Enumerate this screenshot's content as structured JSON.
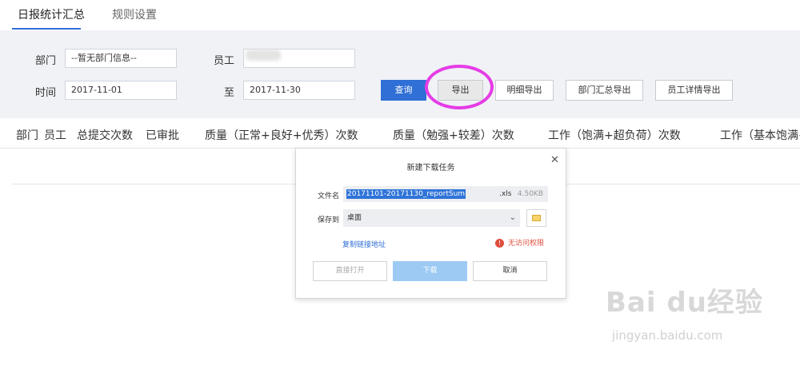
{
  "tabs": {
    "active": "日报统计汇总",
    "other": "规则设置"
  },
  "filters": {
    "dept_label": "部门",
    "dept_value": "--暂无部门信息--",
    "staff_label": "员工",
    "time_label": "时间",
    "start_date": "2017-11-01",
    "to_label": "至",
    "end_date": "2017-11-30"
  },
  "buttons": {
    "query": "查询",
    "export": "导出",
    "detail_export": "明细导出",
    "dept_summary_export": "部门汇总导出",
    "staff_detail_export": "员工详情导出"
  },
  "table": {
    "headers": [
      "部门",
      "员工",
      "总提交次数",
      "已审批",
      "质量（正常+良好+优秀）次数",
      "质量（勉强+较差）次数",
      "工作（饱满+超负荷）次数",
      "工作（基本饱满+"
    ]
  },
  "dialog": {
    "title": "新建下载任务",
    "close": "✕",
    "filename_label": "文件名",
    "filename_selected": "20171101-20171130_reportSum",
    "filename_ext": ".xls",
    "filesize": "4.50KB",
    "saveto_label": "保存到",
    "saveto_value": "桌面",
    "copy_link": "复制链接地址",
    "warning_icon": "!",
    "warning": "无访问权限",
    "open_direct": "直接打开",
    "download": "下载",
    "cancel": "取消"
  },
  "watermark": {
    "text": "Bai du经验",
    "url": "jingyan.baidu.com"
  },
  "colors": {
    "primary": "#2f6fd6",
    "highlight_circle": "#e53ce6",
    "warning": "#e04f3d"
  }
}
